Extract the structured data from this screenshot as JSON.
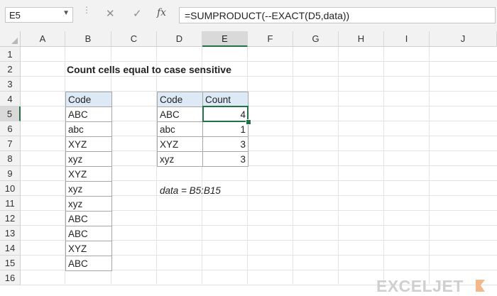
{
  "formula_bar": {
    "name_box": "E5",
    "formula": "=SUMPRODUCT(--EXACT(D5,data))",
    "fx_label": "fx",
    "cancel_glyph": "✕",
    "enter_glyph": "✓"
  },
  "columns": [
    "A",
    "B",
    "C",
    "D",
    "E",
    "F",
    "G",
    "H",
    "I",
    "J"
  ],
  "rows": [
    "1",
    "2",
    "3",
    "4",
    "5",
    "6",
    "7",
    "8",
    "9",
    "10",
    "11",
    "12",
    "13",
    "14",
    "15",
    "16"
  ],
  "selected": {
    "column": "E",
    "row": "5"
  },
  "sheet": {
    "title": "Count cells equal to case sensitive",
    "code_table": {
      "header": "Code",
      "values": [
        "ABC",
        "abc",
        "XYZ",
        "xyz",
        "XYZ",
        "xyz",
        "xyz",
        "ABC",
        "ABC",
        "XYZ",
        "ABC"
      ]
    },
    "count_table": {
      "headers": [
        "Code",
        "Count"
      ],
      "rows": [
        {
          "code": "ABC",
          "count": "4"
        },
        {
          "code": "abc",
          "count": "1"
        },
        {
          "code": "XYZ",
          "count": "3"
        },
        {
          "code": "xyz",
          "count": "3"
        }
      ]
    },
    "note": "data = B5:B15"
  },
  "logo": {
    "text": "EXCELJET",
    "color": "#cfcfcf",
    "mark_color": "#f3b98d"
  },
  "colors": {
    "selection": "#217346",
    "header_fill": "#dde9f5",
    "border": "#a6a6a6"
  }
}
